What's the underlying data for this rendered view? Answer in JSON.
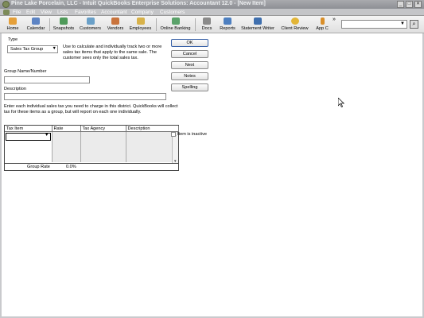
{
  "window": {
    "title": "Pine Lake Porcelain, LLC  - Intuit QuickBooks Enterprise Solutions: Accountant 12.0 - [New Item]",
    "minimize": "_",
    "maximize": "□",
    "close": "✕"
  },
  "menu": [
    "File",
    "Edit",
    "View",
    "Lists",
    "Favorites",
    "Accountant",
    "Company",
    "Customers"
  ],
  "toolbar": {
    "items": [
      "Home",
      "Calendar",
      "Snapshots",
      "Customers",
      "Vendors",
      "Employees",
      "Online Banking",
      "Docs",
      "Reports",
      "Statement Writer",
      "Client Review",
      "App C"
    ],
    "more": "»",
    "search_icon": "magnifier-icon"
  },
  "form": {
    "type_label": "Type",
    "type_value": "Sales Tax Group",
    "type_description": "Use to calculate and individually track two or more sales tax items that apply to the same sale. The customer sees only the total sales tax.",
    "group_name_label": "Group Name/Number",
    "group_name_value": "",
    "description_label": "Description",
    "description_value": "",
    "instructions": "Enter each individual sales tax you need to charge in this district.  QuickBooks will collect tax for these items as a group, but will report on each one individually.",
    "table": {
      "headers": [
        "Tax Item",
        "Rate",
        "Tax Agency",
        "Description"
      ],
      "rows": []
    },
    "group_rate_label": "Group Rate",
    "group_rate_value": "0.0%",
    "inactive_label": "Item is inactive"
  },
  "buttons": {
    "ok": "OK",
    "cancel": "Cancel",
    "next": "Next",
    "notes": "Notes",
    "spelling": "Spelling"
  },
  "colors": {
    "titlebar": "#9a9b9f",
    "menubar": "#c4c5c8",
    "accent": "#7d8b59"
  }
}
